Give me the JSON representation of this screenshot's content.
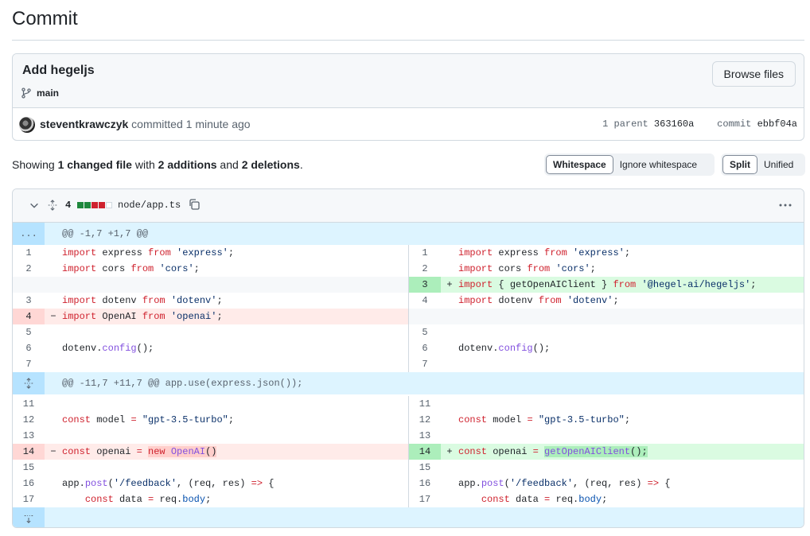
{
  "page": {
    "title": "Commit"
  },
  "commit": {
    "message": "Add hegeljs",
    "branch": "main",
    "browse_label": "Browse files",
    "author": "steventkrawczyk",
    "action_text": " committed 1 minute ago",
    "parent_label": "1 parent",
    "parent_sha": "363160a",
    "commit_label": "commit",
    "commit_sha": "ebbf04a"
  },
  "summary": {
    "prefix": "Showing ",
    "changed": "1 changed file",
    "mid1": " with ",
    "additions": "2 additions",
    "mid2": " and ",
    "deletions": "2 deletions",
    "suffix": "."
  },
  "whitespace_toggle": {
    "options": [
      "Whitespace",
      "Ignore whitespace"
    ],
    "selected": "Whitespace"
  },
  "view_toggle": {
    "options": [
      "Split",
      "Unified"
    ],
    "selected": "Split"
  },
  "file": {
    "change_count": "4",
    "diffstat": [
      "add",
      "add",
      "del",
      "del",
      "neutral"
    ],
    "path": "node/app.ts",
    "expand_top_label": "...",
    "hunk1_header": "@@ -1,7 +1,7 @@",
    "hunk2_header": "@@ -11,7 +11,7 @@ app.use(express.json());"
  },
  "colors": {
    "addition": "#1f883d",
    "deletion": "#cf222e",
    "hunk_bg": "#ddf4ff"
  },
  "diff_lines": {
    "l1": "1",
    "l2": "2",
    "l3": "3",
    "l4": "4",
    "l5": "5",
    "l6": "6",
    "l7": "7",
    "l11": "11",
    "l12": "12",
    "l13": "13",
    "l14": "14",
    "l15": "15",
    "l16": "16",
    "l17": "17",
    "minus": "−",
    "plus": "+"
  }
}
